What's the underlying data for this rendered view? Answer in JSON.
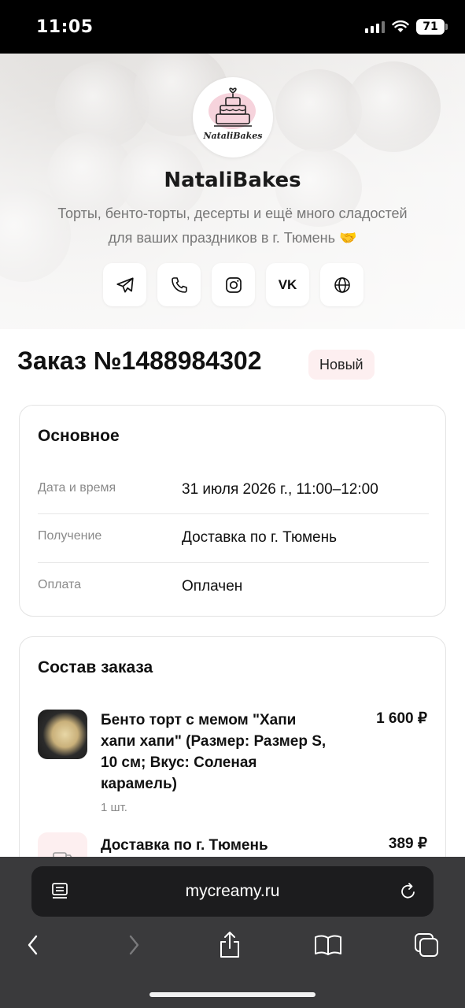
{
  "status_bar": {
    "time": "11:05",
    "battery": "71"
  },
  "shop": {
    "logo_text": "NataliBakes",
    "name": "NataliBakes",
    "description_line1": "Торты, бенто-торты, десерты и ещё много сладостей",
    "description_line2": "для ваших праздников в г. Тюмень 🤝",
    "social": [
      {
        "icon": "telegram-icon"
      },
      {
        "icon": "phone-icon"
      },
      {
        "icon": "instagram-icon"
      },
      {
        "icon": "vk-icon",
        "label": "VK"
      },
      {
        "icon": "globe-icon"
      }
    ]
  },
  "order": {
    "title": "Заказ №1488984302",
    "status": "Новый"
  },
  "main_card": {
    "title": "Основное",
    "rows": [
      {
        "label": "Дата и время",
        "value": "31 июля 2026 г., 11:00–12:00"
      },
      {
        "label": "Получение",
        "value": "Доставка по г. Тюмень"
      },
      {
        "label": "Оплата",
        "value": "Оплачен"
      }
    ]
  },
  "items_card": {
    "title": "Состав заказа",
    "items": [
      {
        "name_lines": [
          "Бенто торт с мемом \"Хапи",
          "хапи хапи\" (Размер: Размер S,",
          "10 см; Вкус: Соленая",
          "карамель)"
        ],
        "price": "1 600 ₽",
        "qty": "1 шт."
      },
      {
        "name_lines": [
          "Доставка по г. Тюмень"
        ],
        "price": "389 ₽"
      }
    ]
  },
  "browser": {
    "url": "mycreamy.ru"
  },
  "colors": {
    "badge_bg": "#fdeff0",
    "accent_pink": "#f6d3dc",
    "browser_bg": "#3a3a3c"
  }
}
